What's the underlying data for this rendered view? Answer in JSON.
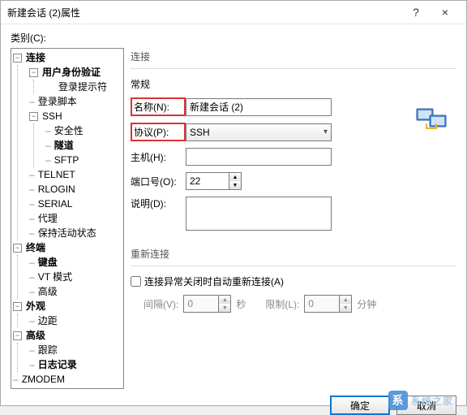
{
  "window": {
    "title": "新建会话 (2)属性",
    "help": "?",
    "close": "×"
  },
  "category_label": "类别(C):",
  "tree": {
    "connection": "连接",
    "user_auth": "用户身份验证",
    "login_prompt": "登录提示符",
    "login_script": "登录脚本",
    "ssh": "SSH",
    "security": "安全性",
    "tunnel": "隧道",
    "sftp": "SFTP",
    "telnet": "TELNET",
    "rlogin": "RLOGIN",
    "serial": "SERIAL",
    "proxy": "代理",
    "keepalive": "保持活动状态",
    "terminal": "终端",
    "keyboard": "键盘",
    "vt_mode": "VT 模式",
    "advanced_term": "高级",
    "appearance": "外观",
    "margin": "边距",
    "advanced": "高级",
    "trace": "跟踪",
    "logging": "日志记录",
    "zmodem": "ZMODEM"
  },
  "right": {
    "section": "连接",
    "general": "常规",
    "name_label": "名称(N):",
    "name_value": "新建会话 (2)",
    "protocol_label": "协议(P):",
    "protocol_value": "SSH",
    "host_label": "主机(H):",
    "host_value": "",
    "port_label": "端口号(O):",
    "port_value": "22",
    "desc_label": "说明(D):",
    "desc_value": ""
  },
  "reconnect": {
    "section": "重新连接",
    "checkbox_label": "连接异常关闭时自动重新连接(A)",
    "interval_label": "间隔(V):",
    "interval_value": "0",
    "seconds": "秒",
    "limit_label": "限制(L):",
    "limit_value": "0",
    "minutes": "分钟"
  },
  "footer": {
    "ok": "确定",
    "cancel": "取消"
  },
  "watermark": "系统之家"
}
